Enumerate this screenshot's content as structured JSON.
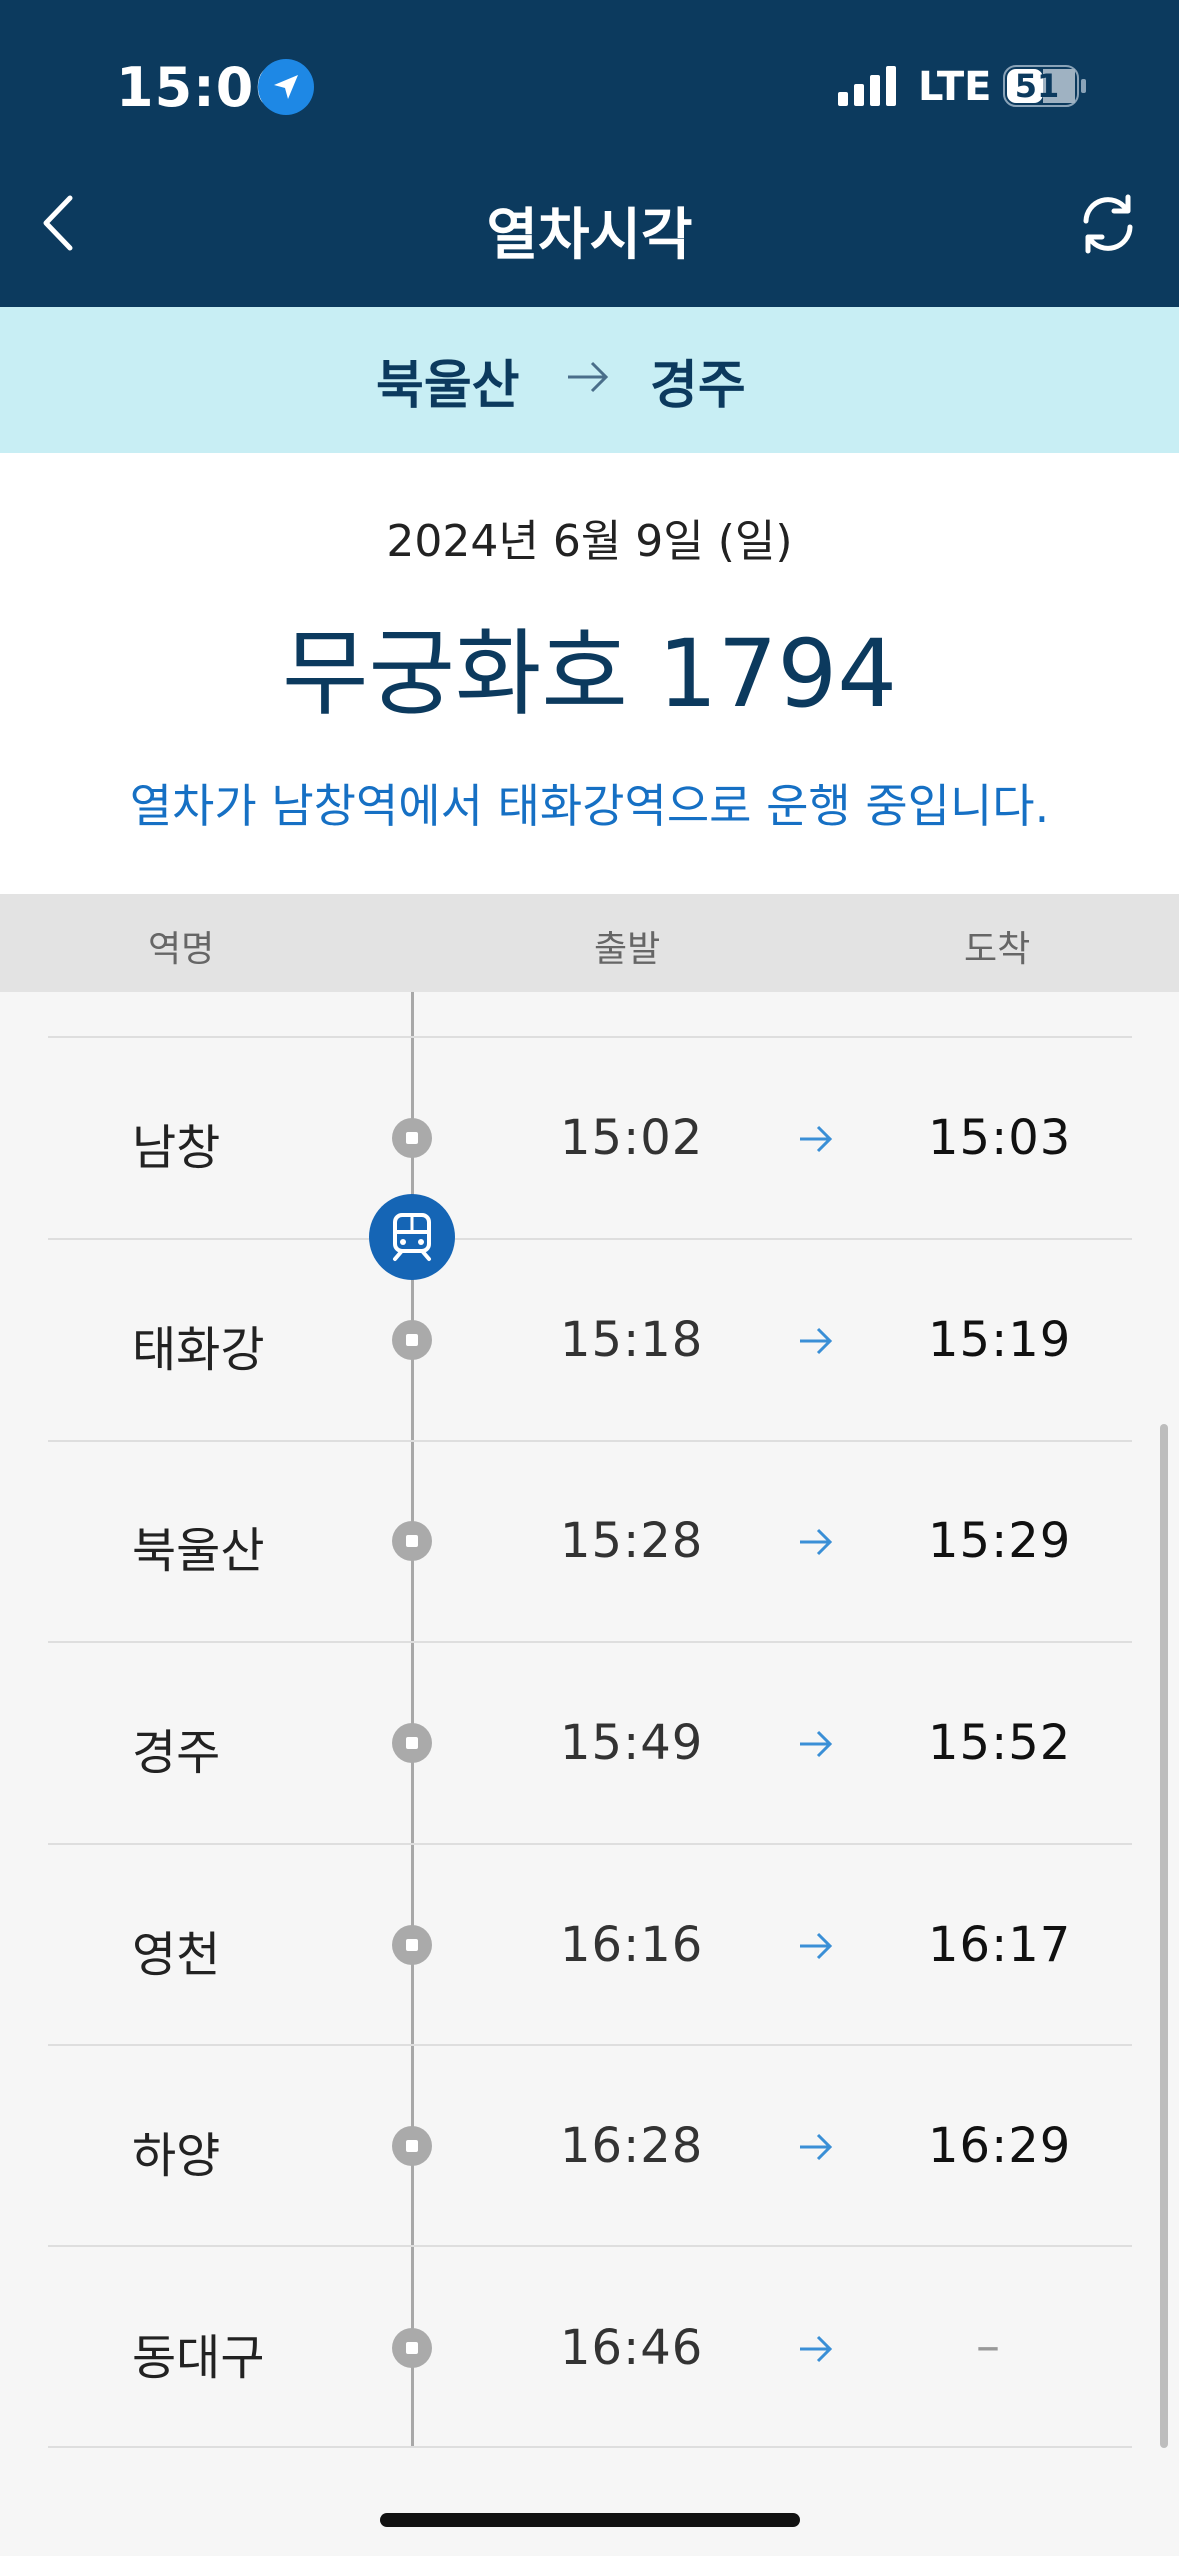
{
  "status_bar": {
    "time": "15:06",
    "network": "LTE",
    "battery": "51"
  },
  "nav": {
    "title": "열차시각"
  },
  "route": {
    "from": "북울산",
    "to": "경주"
  },
  "info": {
    "date": "2024년 6월 9일 (일)",
    "train": "무궁화호 1794",
    "message": "열차가 남창역에서 태화강역으로 운행 중입니다."
  },
  "table": {
    "headers": {
      "station": "역명",
      "departure": "출발",
      "arrival": "도착"
    },
    "rows": [
      {
        "station": "남창",
        "departure": "15:02",
        "arrival": "15:03"
      },
      {
        "station": "태화강",
        "departure": "15:18",
        "arrival": "15:19"
      },
      {
        "station": "북울산",
        "departure": "15:28",
        "arrival": "15:29"
      },
      {
        "station": "경주",
        "departure": "15:49",
        "arrival": "15:52"
      },
      {
        "station": "영천",
        "departure": "16:16",
        "arrival": "16:17"
      },
      {
        "station": "하양",
        "departure": "16:28",
        "arrival": "16:29"
      },
      {
        "station": "동대구",
        "departure": "16:46",
        "arrival": "–"
      }
    ]
  },
  "colors": {
    "navy": "#0c3a5e",
    "route_band": "#c8eef4",
    "accent_blue": "#1670c4",
    "marker": "#1565b5"
  },
  "icons": {
    "location": "location-arrow-icon",
    "back": "chevron-left-icon",
    "refresh": "refresh-icon",
    "train": "train-icon",
    "arrow": "arrow-right-icon"
  }
}
